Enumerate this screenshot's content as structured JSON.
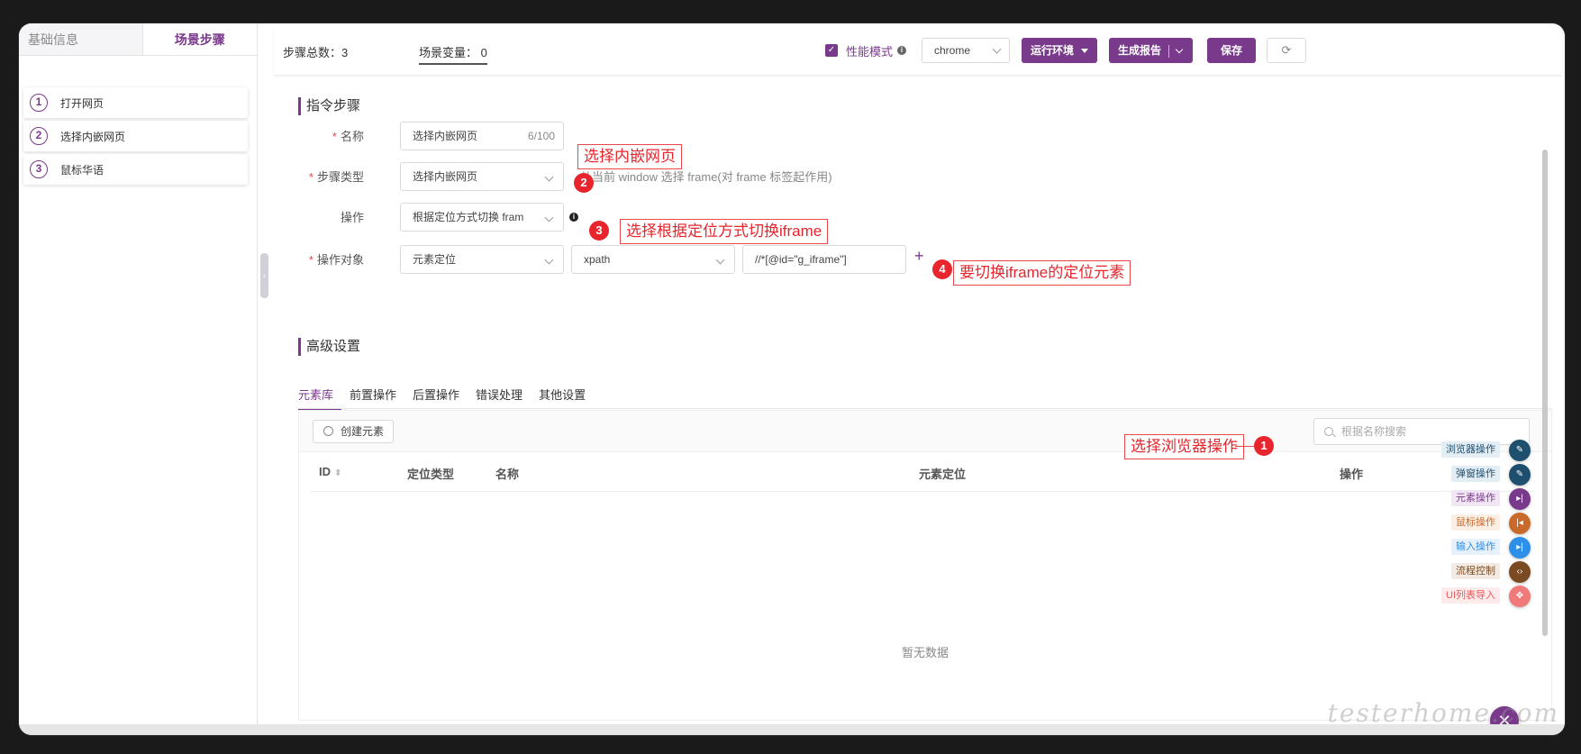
{
  "sidebar": {
    "tabs": [
      "基础信息",
      "场景步骤"
    ],
    "steps": [
      {
        "num": "1",
        "label": "打开网页"
      },
      {
        "num": "2",
        "label": "选择内嵌网页"
      },
      {
        "num": "3",
        "label": "鼠标华语"
      }
    ]
  },
  "topbar": {
    "steps_total": "步骤总数：3",
    "scene_vars": "场景变量：  0",
    "perf_mode": "性能模式",
    "browser": "chrome",
    "run_env": "运行环境",
    "gen_report": "生成报告",
    "save": "保存"
  },
  "instruction": {
    "title": "指令步骤",
    "name_label": "名称",
    "name_value": "选择内嵌网页",
    "name_counter": "6/100",
    "step_type_label": "步骤类型",
    "step_type_value": "选择内嵌网页",
    "step_type_hint": "从当前 window 选择 frame(对 frame 标签起作用)",
    "op_label": "操作",
    "op_value": "根据定位方式切换 fram",
    "target_label": "操作对象",
    "target_type": "元素定位",
    "locator_type": "xpath",
    "locator_value": "//*[@id=\"g_iframe\"]"
  },
  "annotations": {
    "a1": {
      "num": "1",
      "text": "选择浏览器操作"
    },
    "a2": {
      "num": "2",
      "text": "选择内嵌网页"
    },
    "a3": {
      "num": "3",
      "text": "选择根据定位方式切换iframe"
    },
    "a4": {
      "num": "4",
      "text": "要切换iframe的定位元素"
    }
  },
  "advanced": {
    "title": "高级设置",
    "tabs": [
      "元素库",
      "前置操作",
      "后置操作",
      "错误处理",
      "其他设置"
    ],
    "create_element": "创建元素",
    "search_placeholder": "根据名称搜索",
    "columns": {
      "id": "ID",
      "locate_type": "定位类型",
      "name": "名称",
      "locator": "元素定位",
      "action": "操作"
    },
    "empty": "暂无数据"
  },
  "fab_menu": [
    {
      "label": "浏览器操作",
      "icon": "pencil-icon",
      "color": "#1f4f6e",
      "tag_bg": "#e3edf4",
      "tag_color": "#1f4f6e"
    },
    {
      "label": "弹窗操作",
      "icon": "pencil-icon",
      "color": "#1f4f6e",
      "tag_bg": "#e3edf4",
      "tag_color": "#1f4f6e"
    },
    {
      "label": "元素操作",
      "icon": "skip-next-icon",
      "color": "#7a3a8c",
      "tag_bg": "#f1e7f4",
      "tag_color": "#7a3a8c"
    },
    {
      "label": "鼠标操作",
      "icon": "skip-prev-icon",
      "color": "#c96a2a",
      "tag_bg": "#fbeee3",
      "tag_color": "#c96a2a"
    },
    {
      "label": "输入操作",
      "icon": "skip-next-icon",
      "color": "#2e8fe8",
      "tag_bg": "#e6f1fc",
      "tag_color": "#2e8fe8"
    },
    {
      "label": "流程控制",
      "icon": "code-icon",
      "color": "#7a4a22",
      "tag_bg": "#f3ebe3",
      "tag_color": "#7a4a22"
    },
    {
      "label": "UI列表导入",
      "icon": "move-icon",
      "color": "#f07a7a",
      "tag_bg": "#fdeaea",
      "tag_color": "#e85a5a"
    }
  ],
  "watermark": "testerhome.com"
}
